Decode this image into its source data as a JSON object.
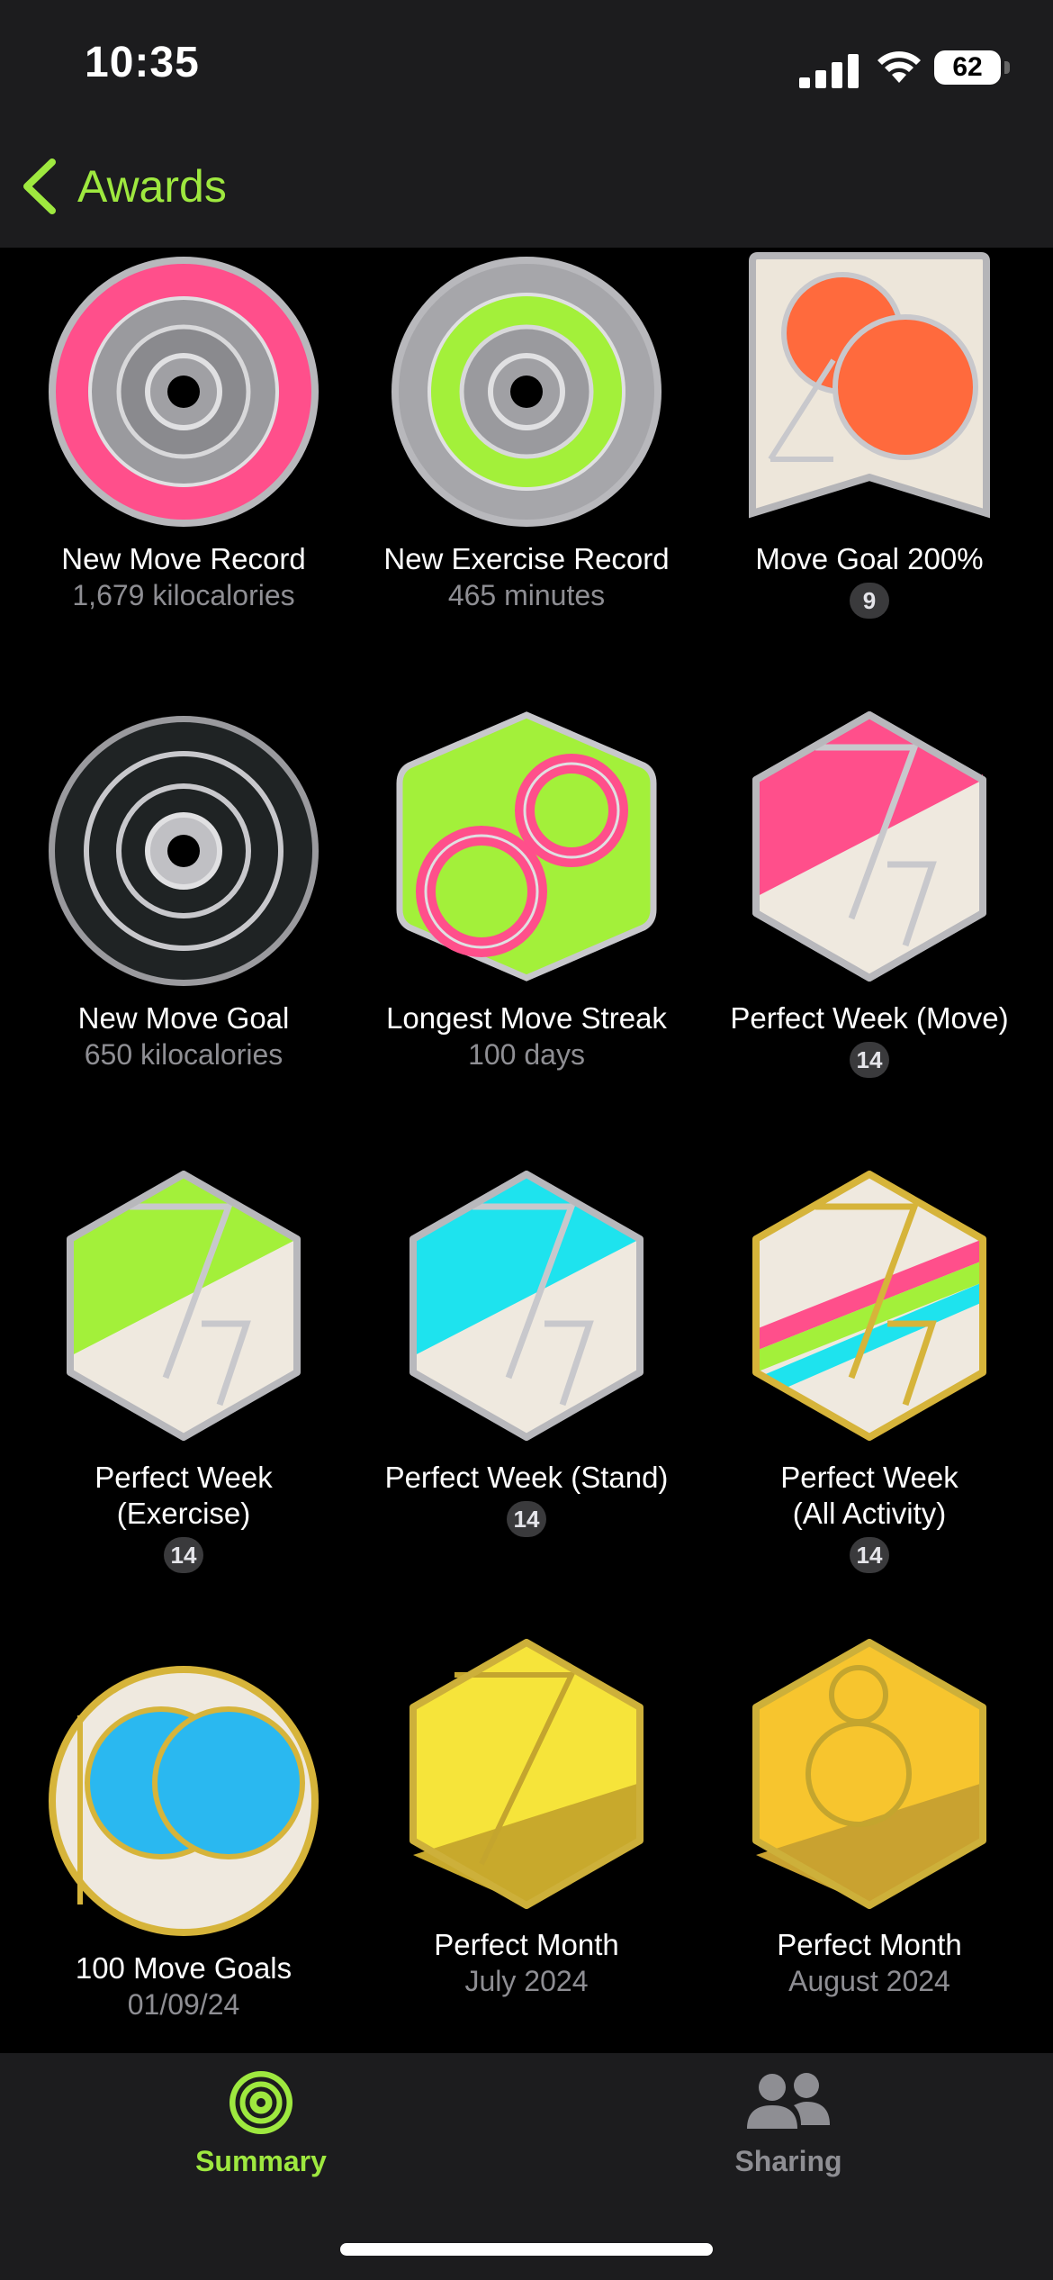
{
  "status": {
    "time": "10:35",
    "battery": "62"
  },
  "nav": {
    "back_label": "Awards"
  },
  "colors": {
    "accent": "#9ee83f",
    "move": "#ff2d75",
    "exercise": "#a3f03a",
    "stand": "#1ee3ee",
    "gold": "#d6b43a"
  },
  "awards": [
    {
      "title": "New Move Record",
      "subtitle": "1,679 kilocalories",
      "icon": "move-record-ring"
    },
    {
      "title": "New Exercise Record",
      "subtitle": "465 minutes",
      "icon": "exercise-record-ring"
    },
    {
      "title": "Move Goal 200%",
      "count": "9",
      "icon": "move-goal-200-badge"
    },
    {
      "title": "New Move Goal",
      "subtitle": "650 kilocalories",
      "icon": "new-move-goal-ring"
    },
    {
      "title": "Longest Move Streak",
      "subtitle": "100 days",
      "icon": "longest-streak-badge"
    },
    {
      "title": "Perfect Week (Move)",
      "count": "14",
      "icon": "perfect-week-move-badge"
    },
    {
      "title_line1": "Perfect Week",
      "title_line2": "(Exercise)",
      "count": "14",
      "icon": "perfect-week-exercise-badge"
    },
    {
      "title": "Perfect Week (Stand)",
      "count": "14",
      "icon": "perfect-week-stand-badge"
    },
    {
      "title_line1": "Perfect Week",
      "title_line2": "(All Activity)",
      "count": "14",
      "icon": "perfect-week-all-badge"
    },
    {
      "title": "100 Move Goals",
      "subtitle": "01/09/24",
      "icon": "100-move-goals-badge"
    },
    {
      "title": "Perfect Month",
      "subtitle": "July 2024",
      "icon": "perfect-month-july-badge"
    },
    {
      "title": "Perfect Month",
      "subtitle": "August 2024",
      "icon": "perfect-month-august-badge"
    }
  ],
  "tabs": [
    {
      "label": "Summary",
      "active": true,
      "icon": "summary-rings-icon"
    },
    {
      "label": "Sharing",
      "active": false,
      "icon": "sharing-people-icon"
    }
  ]
}
